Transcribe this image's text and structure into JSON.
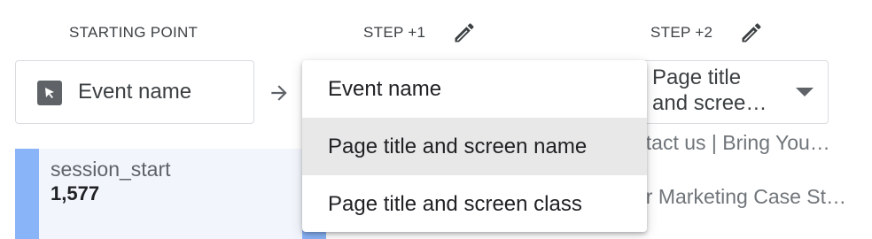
{
  "columns": [
    {
      "header": "STARTING POINT"
    },
    {
      "header": "STEP +1"
    },
    {
      "header": "STEP +2"
    }
  ],
  "start_node": {
    "label": "Event name",
    "icon": "cursor-icon"
  },
  "step2_node": {
    "line1": "Page title",
    "line2": "and scree…"
  },
  "starting_bar": {
    "name": "session_start",
    "value": "1,577",
    "accent_color": "#8ab4f8",
    "bg_color": "#f3f5fd"
  },
  "right_rows": [
    {
      "text": "ntact us | Bring You…"
    },
    {
      "text": "ur Marketing Case St…"
    }
  ],
  "dimension_menu": {
    "items": [
      {
        "label": "Event name",
        "selected": false
      },
      {
        "label": "Page title and screen name",
        "selected": true
      },
      {
        "label": "Page title and screen class",
        "selected": false
      }
    ]
  }
}
